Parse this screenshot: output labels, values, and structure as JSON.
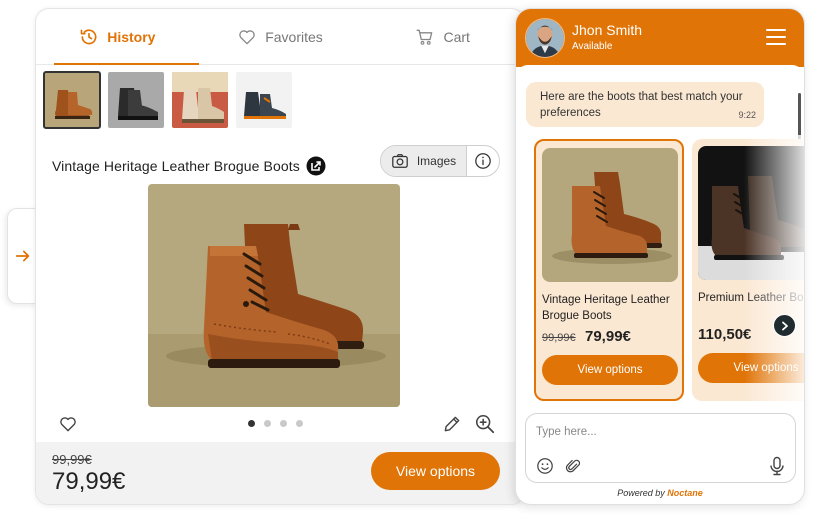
{
  "tabs": [
    {
      "label": "History",
      "icon": "history-icon",
      "active": true
    },
    {
      "label": "Favorites",
      "icon": "heart-icon",
      "active": false
    },
    {
      "label": "Cart",
      "icon": "cart-icon",
      "active": false
    }
  ],
  "product": {
    "title": "Vintage Heritage Leather Brogue Boots",
    "images_label": "Images",
    "old_price": "99,99€",
    "new_price": "79,99€",
    "view_options": "View options",
    "carousel": {
      "count": 4,
      "active": 0
    }
  },
  "chat": {
    "agent_name": "Jhon Smith",
    "agent_status": "Available",
    "message": "Here are the boots that best match your preferences",
    "message_time": "9:22",
    "cards": [
      {
        "title": "Vintage Heritage Leather Brogue Boots",
        "old_price": "99,99€",
        "new_price": "79,99€",
        "button": "View options"
      },
      {
        "title": "Premium Leather Boots Oxford Elite",
        "old_price": "",
        "new_price": "110,50€",
        "button": "View options"
      }
    ],
    "input_placeholder": "Type here...",
    "powered_by": "Powered by",
    "brand": "Noctane"
  },
  "colors": {
    "accent": "#e07406",
    "bubble": "#fbe8d3"
  }
}
